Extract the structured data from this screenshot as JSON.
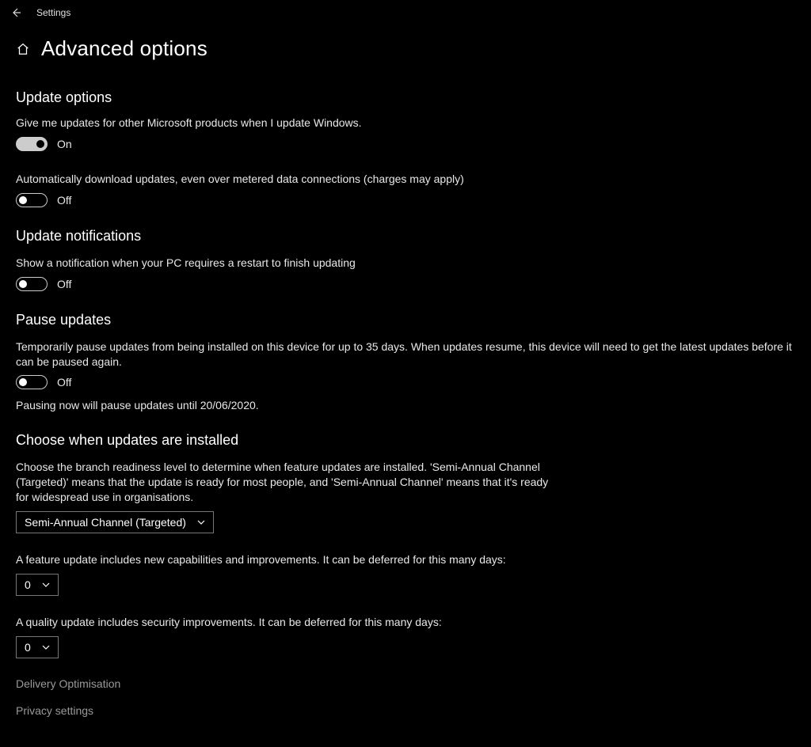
{
  "titlebar": {
    "app_name": "Settings"
  },
  "page": {
    "title": "Advanced options"
  },
  "sections": {
    "update_options": {
      "heading": "Update options",
      "microsoft_products": {
        "desc": "Give me updates for other Microsoft products when I update Windows.",
        "state_label": "On",
        "on": true
      },
      "metered": {
        "desc": "Automatically download updates, even over metered data connections (charges may apply)",
        "state_label": "Off",
        "on": false
      }
    },
    "update_notifications": {
      "heading": "Update notifications",
      "restart_notify": {
        "desc": "Show a notification when your PC requires a restart to finish updating",
        "state_label": "Off",
        "on": false
      }
    },
    "pause_updates": {
      "heading": "Pause updates",
      "desc": "Temporarily pause updates from being installed on this device for up to 35 days. When updates resume, this device will need to get the latest updates before it can be paused again.",
      "state_label": "Off",
      "on": false,
      "note": "Pausing now will pause updates until 20/06/2020."
    },
    "choose_when": {
      "heading": "Choose when updates are installed",
      "branch_desc": "Choose the branch readiness level to determine when feature updates are installed. 'Semi-Annual Channel (Targeted)' means that the update is ready for most people, and 'Semi-Annual Channel' means that it's ready for widespread use in organisations.",
      "branch_value": "Semi-Annual Channel (Targeted)",
      "feature_defer_desc": "A feature update includes new capabilities and improvements. It can be deferred for this many days:",
      "feature_defer_value": "0",
      "quality_defer_desc": "A quality update includes security improvements. It can be deferred for this many days:",
      "quality_defer_value": "0"
    }
  },
  "links": {
    "delivery": "Delivery Optimisation",
    "privacy": "Privacy settings"
  }
}
